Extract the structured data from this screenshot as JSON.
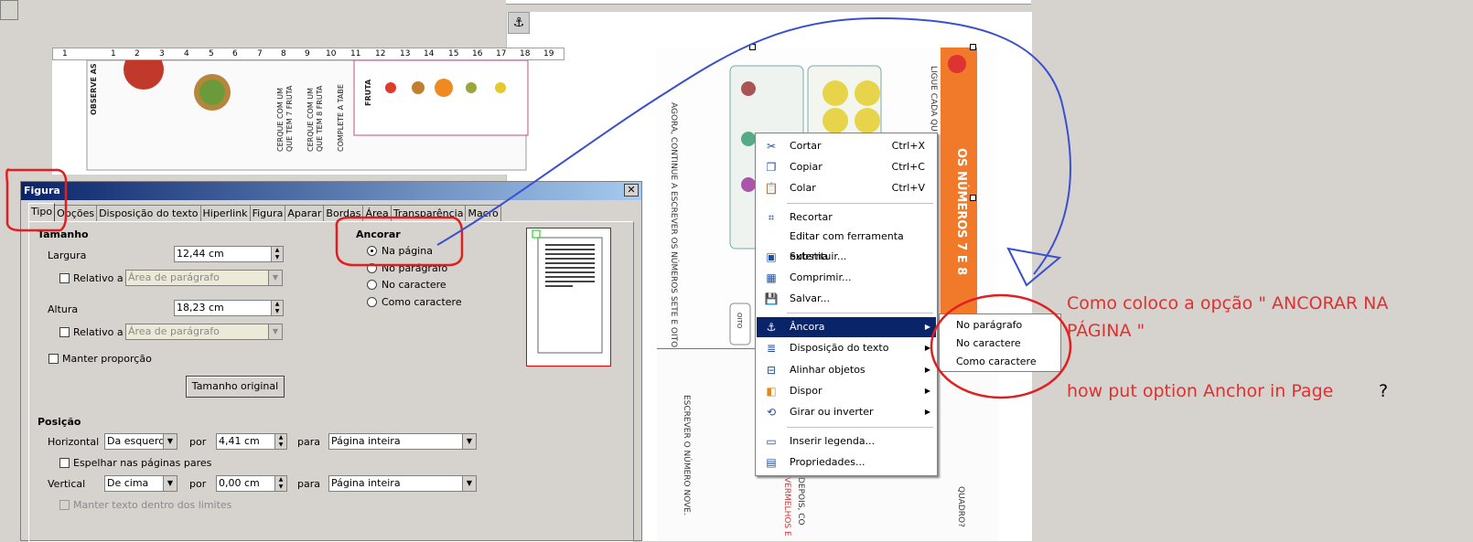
{
  "ruler": {
    "marks": [
      "1",
      "1",
      "2",
      "3",
      "4",
      "5",
      "6",
      "7",
      "8",
      "9",
      "10",
      "11",
      "12",
      "13",
      "14",
      "15",
      "16",
      "17",
      "18",
      "19"
    ]
  },
  "dialog": {
    "title": "Figura",
    "tabs": [
      "Tipo",
      "Opções",
      "Disposição do texto",
      "Hiperlink",
      "Figura",
      "Aparar",
      "Bordas",
      "Área",
      "Transparência",
      "Macro"
    ],
    "active_tab": "Tipo",
    "tamanho": {
      "heading": "Tamanho",
      "largura_label": "Largura",
      "largura_value": "12,44 cm",
      "relativo1_label": "Relativo a",
      "relativo1_value": "Área de parágrafo",
      "altura_label": "Altura",
      "altura_value": "18,23 cm",
      "relativo2_label": "Relativo a",
      "relativo2_value": "Área de parágrafo",
      "manter_label": "Manter proporção",
      "tamanho_original_button": "Tamanho original"
    },
    "ancorar": {
      "heading": "Ancorar",
      "options": [
        "Na página",
        "No parágrafo",
        "No caractere",
        "Como caractere"
      ],
      "selected": "Na página"
    },
    "posicao": {
      "heading": "Posição",
      "horizontal_label": "Horizontal",
      "horizontal_value": "Da esquerda",
      "por_label": "por",
      "horizontal_by": "4,41 cm",
      "para_label": "para",
      "horizontal_to": "Página inteira",
      "espelhar_label": "Espelhar nas páginas pares",
      "vertical_label": "Vertical",
      "vertical_value": "De cima",
      "vertical_by": "0,00 cm",
      "vertical_to": "Página inteira",
      "manter_texto_label": "Manter texto dentro dos limites"
    }
  },
  "context_menu": {
    "items": [
      {
        "icon": "scissors-icon",
        "label": "Cortar",
        "shortcut": "Ctrl+X"
      },
      {
        "icon": "copy-icon",
        "label": "Copiar",
        "shortcut": "Ctrl+C"
      },
      {
        "icon": "paste-icon",
        "label": "Colar",
        "shortcut": "Ctrl+V"
      },
      {
        "icon": "crop-icon",
        "label": "Recortar",
        "shortcut": ""
      },
      {
        "icon": "",
        "label": "Editar com ferramenta externa",
        "shortcut": ""
      },
      {
        "icon": "image-replace-icon",
        "label": "Substituir...",
        "shortcut": ""
      },
      {
        "icon": "compress-icon",
        "label": "Comprimir...",
        "shortcut": ""
      },
      {
        "icon": "save-icon",
        "label": "Salvar...",
        "shortcut": ""
      },
      {
        "icon": "anchor-icon",
        "label": "Âncora",
        "shortcut": ""
      },
      {
        "icon": "wrap-icon",
        "label": "Disposição do texto",
        "shortcut": ""
      },
      {
        "icon": "align-icon",
        "label": "Alinhar objetos",
        "shortcut": ""
      },
      {
        "icon": "arrange-icon",
        "label": "Dispor",
        "shortcut": ""
      },
      {
        "icon": "rotate-icon",
        "label": "Girar ou inverter",
        "shortcut": ""
      },
      {
        "icon": "caption-icon",
        "label": "Inserir legenda...",
        "shortcut": ""
      },
      {
        "icon": "properties-icon",
        "label": "Propriedades...",
        "shortcut": ""
      }
    ],
    "submenu": [
      "No parágrafo",
      "No caractere",
      "Como caractere"
    ]
  },
  "document_left": {
    "vertical_texts": [
      "OBSERVE AS FRUT",
      "CERQUE COM UM",
      "QUE TEM 7 FRUTA",
      "CERQUE COM UM",
      "QUE TEM 8 FRUTA",
      "COMPLETE A TABE",
      "FRUTA"
    ]
  },
  "document_right": {
    "vertical_texts": [
      "AGORA, CONTINUE A ESCREVER OS NÚMEROS SETE E OITO.",
      "LIGUE CADA QU",
      "OS NÚMEROS 7 E 8",
      "OITO",
      "ESCREVER O NÚMERO NOVE.",
      "VERMELHOS E",
      "DEPOIS, CO",
      "QUADRO?"
    ]
  },
  "annotation": {
    "line1": "Como coloco a opção \" ANCORAR NA",
    "line2": "PÁGINA \"",
    "line3": "how put option Anchor in Page",
    "qmark": "?"
  },
  "colors": {
    "annotation_red": "#e03030",
    "menu_highlight": "#0a246a",
    "pen_blue": "#3a4fd0"
  }
}
